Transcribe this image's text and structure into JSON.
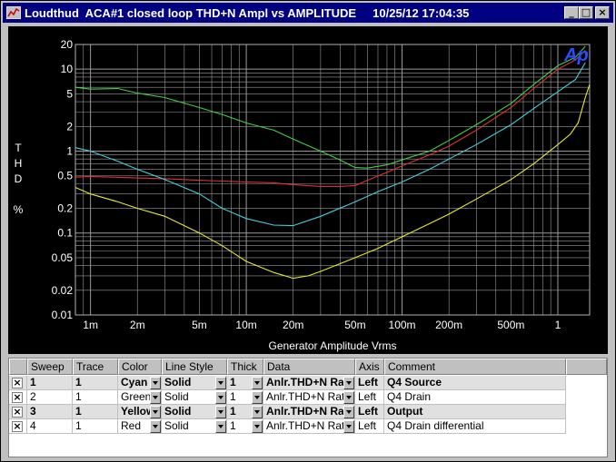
{
  "window": {
    "title": "Loudthud  ACA#1 closed loop THD+N Ampl vs AMPLITUDE     10/25/12 17:04:35",
    "minimize_glyph": "_",
    "maximize_glyph": "□",
    "close_glyph": "×"
  },
  "chart_data": {
    "type": "line",
    "title": "",
    "logo": "Ap",
    "xlabel": "Generator Amplitude Vrms",
    "ylabel_lines": [
      "T",
      "H",
      "D",
      "",
      "%"
    ],
    "xscale": "log",
    "yscale": "log",
    "xlim": [
      0.0008,
      1.6
    ],
    "ylim": [
      0.01,
      20
    ],
    "grid": true,
    "x_ticks": [
      {
        "v": 0.001,
        "label": "1m"
      },
      {
        "v": 0.002,
        "label": "2m"
      },
      {
        "v": 0.005,
        "label": "5m"
      },
      {
        "v": 0.01,
        "label": "10m"
      },
      {
        "v": 0.02,
        "label": "20m"
      },
      {
        "v": 0.05,
        "label": "50m"
      },
      {
        "v": 0.1,
        "label": "100m"
      },
      {
        "v": 0.2,
        "label": "200m"
      },
      {
        "v": 0.5,
        "label": "500m"
      },
      {
        "v": 1,
        "label": "1"
      }
    ],
    "y_ticks": [
      {
        "v": 20,
        "label": "20"
      },
      {
        "v": 10,
        "label": "10"
      },
      {
        "v": 5,
        "label": "5"
      },
      {
        "v": 2,
        "label": "2"
      },
      {
        "v": 1,
        "label": "1"
      },
      {
        "v": 0.5,
        "label": "0.5"
      },
      {
        "v": 0.2,
        "label": "0.2"
      },
      {
        "v": 0.1,
        "label": "0.1"
      },
      {
        "v": 0.05,
        "label": "0.05"
      },
      {
        "v": 0.02,
        "label": "0.02"
      },
      {
        "v": 0.01,
        "label": "0.01"
      }
    ],
    "series": [
      {
        "name": "Q4 Drain",
        "color": "#40d040",
        "points": [
          [
            0.0008,
            6.0
          ],
          [
            0.001,
            5.7
          ],
          [
            0.0015,
            5.8
          ],
          [
            0.002,
            5.1
          ],
          [
            0.003,
            4.5
          ],
          [
            0.005,
            3.4
          ],
          [
            0.007,
            2.8
          ],
          [
            0.01,
            2.2
          ],
          [
            0.015,
            1.8
          ],
          [
            0.02,
            1.4
          ],
          [
            0.03,
            1.0
          ],
          [
            0.04,
            0.78
          ],
          [
            0.05,
            0.63
          ],
          [
            0.06,
            0.62
          ],
          [
            0.08,
            0.68
          ],
          [
            0.1,
            0.78
          ],
          [
            0.15,
            1.0
          ],
          [
            0.2,
            1.35
          ],
          [
            0.3,
            2.1
          ],
          [
            0.5,
            3.8
          ],
          [
            0.7,
            6.5
          ],
          [
            1.0,
            11.0
          ],
          [
            1.3,
            14.0
          ],
          [
            1.5,
            19.0
          ]
        ]
      },
      {
        "name": "Q4 Drain differential",
        "color": "#e03030",
        "points": [
          [
            0.0008,
            0.48
          ],
          [
            0.001,
            0.49
          ],
          [
            0.002,
            0.47
          ],
          [
            0.003,
            0.46
          ],
          [
            0.005,
            0.44
          ],
          [
            0.007,
            0.43
          ],
          [
            0.01,
            0.42
          ],
          [
            0.015,
            0.41
          ],
          [
            0.02,
            0.39
          ],
          [
            0.03,
            0.37
          ],
          [
            0.04,
            0.37
          ],
          [
            0.05,
            0.38
          ],
          [
            0.06,
            0.44
          ],
          [
            0.08,
            0.55
          ],
          [
            0.1,
            0.66
          ],
          [
            0.15,
            0.9
          ],
          [
            0.2,
            1.15
          ],
          [
            0.3,
            1.8
          ],
          [
            0.5,
            3.4
          ],
          [
            0.7,
            5.8
          ],
          [
            1.0,
            10.0
          ],
          [
            1.3,
            13.0
          ],
          [
            1.5,
            17.0
          ]
        ]
      },
      {
        "name": "Q4 Source",
        "color": "#40d0e0",
        "points": [
          [
            0.0008,
            1.1
          ],
          [
            0.001,
            1.0
          ],
          [
            0.0015,
            0.75
          ],
          [
            0.002,
            0.6
          ],
          [
            0.003,
            0.45
          ],
          [
            0.005,
            0.3
          ],
          [
            0.007,
            0.2
          ],
          [
            0.01,
            0.15
          ],
          [
            0.015,
            0.125
          ],
          [
            0.02,
            0.123
          ],
          [
            0.03,
            0.16
          ],
          [
            0.05,
            0.24
          ],
          [
            0.07,
            0.32
          ],
          [
            0.1,
            0.42
          ],
          [
            0.15,
            0.6
          ],
          [
            0.2,
            0.8
          ],
          [
            0.3,
            1.2
          ],
          [
            0.5,
            2.1
          ],
          [
            0.7,
            3.3
          ],
          [
            1.0,
            5.3
          ],
          [
            1.3,
            7.5
          ],
          [
            1.5,
            12.0
          ]
        ]
      },
      {
        "name": "Output",
        "color": "#e8e830",
        "points": [
          [
            0.0008,
            0.36
          ],
          [
            0.001,
            0.3
          ],
          [
            0.0015,
            0.24
          ],
          [
            0.002,
            0.2
          ],
          [
            0.003,
            0.16
          ],
          [
            0.005,
            0.1
          ],
          [
            0.007,
            0.07
          ],
          [
            0.01,
            0.045
          ],
          [
            0.015,
            0.033
          ],
          [
            0.02,
            0.028
          ],
          [
            0.025,
            0.03
          ],
          [
            0.03,
            0.034
          ],
          [
            0.05,
            0.05
          ],
          [
            0.07,
            0.065
          ],
          [
            0.1,
            0.09
          ],
          [
            0.15,
            0.13
          ],
          [
            0.2,
            0.17
          ],
          [
            0.3,
            0.26
          ],
          [
            0.5,
            0.45
          ],
          [
            0.7,
            0.7
          ],
          [
            1.0,
            1.2
          ],
          [
            1.2,
            1.6
          ],
          [
            1.35,
            2.2
          ],
          [
            1.5,
            4.5
          ],
          [
            1.6,
            6.5
          ]
        ]
      }
    ]
  },
  "table": {
    "headers": [
      "",
      "Sweep",
      "Trace",
      "Color",
      "Line Style",
      "Thick",
      "Data",
      "Axis",
      "Comment"
    ],
    "rows": [
      {
        "checked": "×",
        "sweep": "1",
        "trace": "1",
        "color": "Cyan",
        "style": "Solid",
        "thick": "1",
        "data": "Anlr.THD+N Ratio",
        "axis": "Left",
        "comment": "Q4 Source",
        "bold": true
      },
      {
        "checked": "×",
        "sweep": "2",
        "trace": "1",
        "color": "Green",
        "style": "Solid",
        "thick": "1",
        "data": "Anlr.THD+N Ratio",
        "axis": "Left",
        "comment": "Q4 Drain",
        "bold": false
      },
      {
        "checked": "×",
        "sweep": "3",
        "trace": "1",
        "color": "Yellow",
        "style": "Solid",
        "thick": "1",
        "data": "Anlr.THD+N Ratio",
        "axis": "Left",
        "comment": "Output",
        "bold": true
      },
      {
        "checked": "×",
        "sweep": "4",
        "trace": "1",
        "color": "Red",
        "style": "Solid",
        "thick": "1",
        "data": "Anlr.THD+N Ratio",
        "axis": "Left",
        "comment": "Q4 Drain differential",
        "bold": false
      }
    ]
  }
}
